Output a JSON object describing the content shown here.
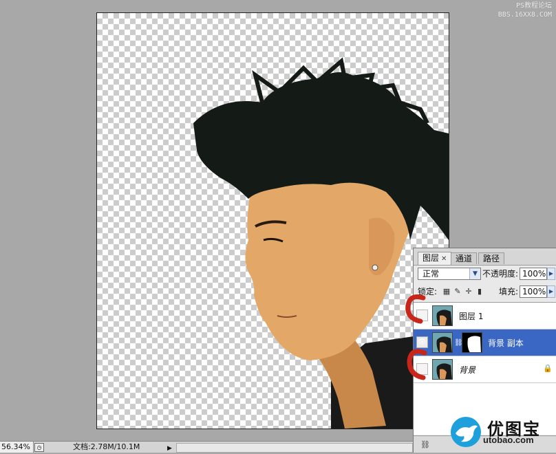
{
  "watermark": {
    "line1": "PS教程论坛",
    "line2": "BBS.16XX8.COM"
  },
  "layers_panel": {
    "tabs": [
      {
        "label": "图层"
      },
      {
        "label": "通道"
      },
      {
        "label": "路径"
      }
    ],
    "blend_mode": "正常",
    "opacity_label": "不透明度:",
    "opacity_value": "100%",
    "lock_label": "锁定:",
    "fill_label": "填充:",
    "fill_value": "100%",
    "layers": [
      {
        "name": "图层 1",
        "visible": false,
        "selected": false
      },
      {
        "name": "背景 副本",
        "visible": true,
        "selected": true
      },
      {
        "name": "背景",
        "visible": false,
        "selected": false,
        "locked": true
      }
    ]
  },
  "status_bar": {
    "zoom": "56.34%",
    "doc_info": "文档:2.78M/10.1M"
  },
  "logo": {
    "text": "优图宝",
    "url": "utobao.com"
  },
  "colors": {
    "selection": "#3a67c4",
    "annotation_red": "#c8261b",
    "logo_bird": "#1ea0dc"
  }
}
